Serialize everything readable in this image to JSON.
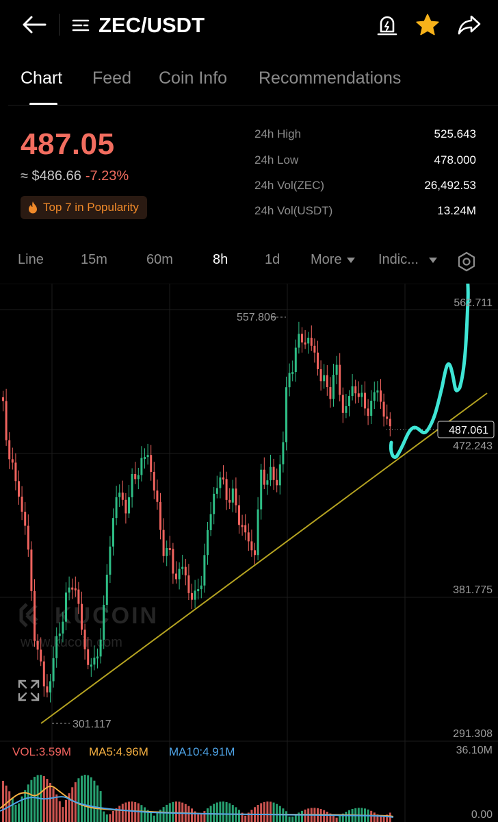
{
  "header": {
    "pair": "ZEC/USDT",
    "back_icon": "arrow-left-icon",
    "menu_icon": "menu-lines-icon",
    "alert_icon": "bell-alert-icon",
    "favorite_icon": "star-icon",
    "share_icon": "share-icon",
    "favorite_color": "#f7b21a"
  },
  "tabs": [
    {
      "label": "Chart",
      "active": true
    },
    {
      "label": "Feed"
    },
    {
      "label": "Coin Info"
    },
    {
      "label": "Recommendations"
    }
  ],
  "ticker": {
    "last_price": "487.05",
    "usd_approx": "≈ $486.66",
    "change_pct": "-7.23%",
    "popularity_badge": "Top 7 in Popularity",
    "price_color": "#f26d5f"
  },
  "stats": [
    {
      "label": "24h High",
      "value": "525.643"
    },
    {
      "label": "24h Low",
      "value": "478.000"
    },
    {
      "label": "24h Vol(ZEC)",
      "value": "26,492.53"
    },
    {
      "label": "24h Vol(USDT)",
      "value": "13.24M"
    }
  ],
  "timeframes": [
    {
      "label": "Line"
    },
    {
      "label": "15m"
    },
    {
      "label": "60m"
    },
    {
      "label": "8h",
      "active": true
    },
    {
      "label": "1d"
    },
    {
      "label": "More"
    },
    {
      "label": "Indic..."
    }
  ],
  "chart": {
    "watermark": "KUCOIN",
    "watermark_url": "www.kucoin.com",
    "max_marker": "557.806",
    "min_marker": "301.117",
    "current_price_label": "487.061",
    "axis_labels": [
      "562.711",
      "472.243",
      "381.775",
      "291.308"
    ],
    "up_color": "#2ebd85",
    "down_color": "#f0635e",
    "trendline_color": "#b5a321",
    "drawn_line_color": "#3fe6d6"
  },
  "volume": {
    "vol": "VOL:3.59M",
    "ma5": "MA5:4.96M",
    "ma10": "MA10:4.91M",
    "axis_top": "36.10M",
    "axis_bottom": "0.00",
    "vol_color": "#f0635e",
    "ma5_color": "#f5b042",
    "ma10_color": "#4ea3e6"
  }
}
